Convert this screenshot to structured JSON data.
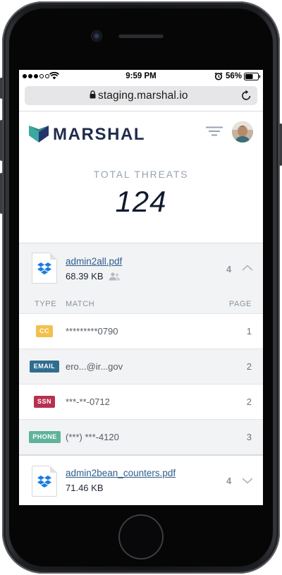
{
  "status_bar": {
    "time": "9:59 PM",
    "battery": "56%",
    "icons": [
      "signal-icon",
      "wifi-icon",
      "alarm-icon",
      "battery-icon"
    ]
  },
  "browser": {
    "url": "staging.marshal.io",
    "icons": [
      "lock-icon",
      "reload-icon"
    ]
  },
  "header": {
    "logo_text": "MARSHAL",
    "brand_color": "#1f2c4a",
    "logo_colors": [
      "#3aa8a0",
      "#2e8a86",
      "#24356a"
    ],
    "icons": [
      "filter-icon",
      "avatar"
    ]
  },
  "summary": {
    "label": "TOTAL THREATS",
    "count": "124"
  },
  "files": [
    {
      "name": "admin2all.pdf",
      "size": "68.39 KB",
      "count": "4",
      "expanded": true,
      "icons": [
        "dropbox-icon",
        "shared-users-icon",
        "chevron-up-icon"
      ],
      "columns": {
        "type": "TYPE",
        "match": "MATCH",
        "page": "PAGE"
      },
      "matches": [
        {
          "type": "CC",
          "match": "*********0790",
          "page": "1",
          "color": "#f2c04c"
        },
        {
          "type": "EMAIL",
          "match": "ero...@ir...gov",
          "page": "2",
          "color": "#2f6d8f"
        },
        {
          "type": "SSN",
          "match": "***-**-0712",
          "page": "2",
          "color": "#b8304f"
        },
        {
          "type": "PHONE",
          "match": "(***) ***-4120",
          "page": "3",
          "color": "#5fb39a"
        }
      ]
    },
    {
      "name": "admin2bean_counters.pdf",
      "size": "71.46 KB",
      "count": "4",
      "expanded": false,
      "icons": [
        "dropbox-icon",
        "chevron-down-icon"
      ]
    }
  ]
}
